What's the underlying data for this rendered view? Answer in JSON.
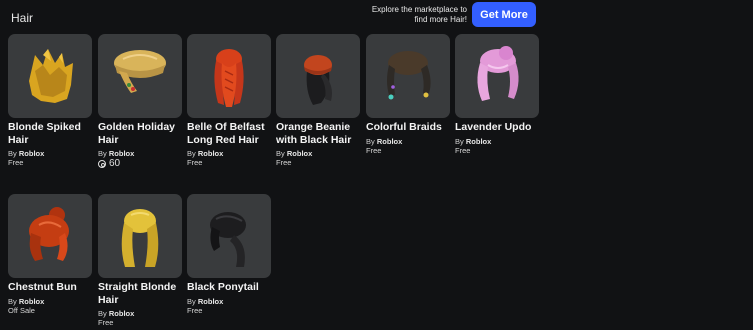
{
  "header": {
    "title": "Hair",
    "promo_text": "Explore the marketplace to find more Hair!",
    "cta_label": "Get More"
  },
  "items": [
    {
      "name": "Blonde Spiked Hair",
      "by": "By",
      "creator": "Roblox",
      "price": "Free",
      "icon": "blonde-spiked-hair-icon",
      "color": "#d9a520"
    },
    {
      "name": "Golden Holiday Hair",
      "by": "By",
      "creator": "Roblox",
      "price": "60",
      "icon": "golden-holiday-hair-icon",
      "color": "#d9b45a"
    },
    {
      "name": "Belle Of Belfast Long Red Hair",
      "by": "By",
      "creator": "Roblox",
      "price": "Free",
      "icon": "long-red-hair-icon",
      "color": "#d8401a"
    },
    {
      "name": "Orange Beanie with Black Hair",
      "by": "By",
      "creator": "Roblox",
      "price": "Free",
      "icon": "orange-beanie-black-hair-icon",
      "color": "#c2451e"
    },
    {
      "name": "Colorful Braids",
      "by": "By",
      "creator": "Roblox",
      "price": "Free",
      "icon": "colorful-braids-icon",
      "color": "#4a3a2a"
    },
    {
      "name": "Lavender Updo",
      "by": "By",
      "creator": "Roblox",
      "price": "Free",
      "icon": "lavender-updo-icon",
      "color": "#e39ad8"
    },
    {
      "name": "Chestnut Bun",
      "by": "By",
      "creator": "Roblox",
      "price": "Off Sale",
      "icon": "chestnut-bun-icon",
      "color": "#c43d12"
    },
    {
      "name": "Straight Blonde Hair",
      "by": "By",
      "creator": "Roblox",
      "price": "Free",
      "icon": "straight-blonde-hair-icon",
      "color": "#e3c23a"
    },
    {
      "name": "Black Ponytail",
      "by": "By",
      "creator": "Roblox",
      "price": "Free",
      "icon": "black-ponytail-icon",
      "color": "#1d1d1f"
    }
  ]
}
